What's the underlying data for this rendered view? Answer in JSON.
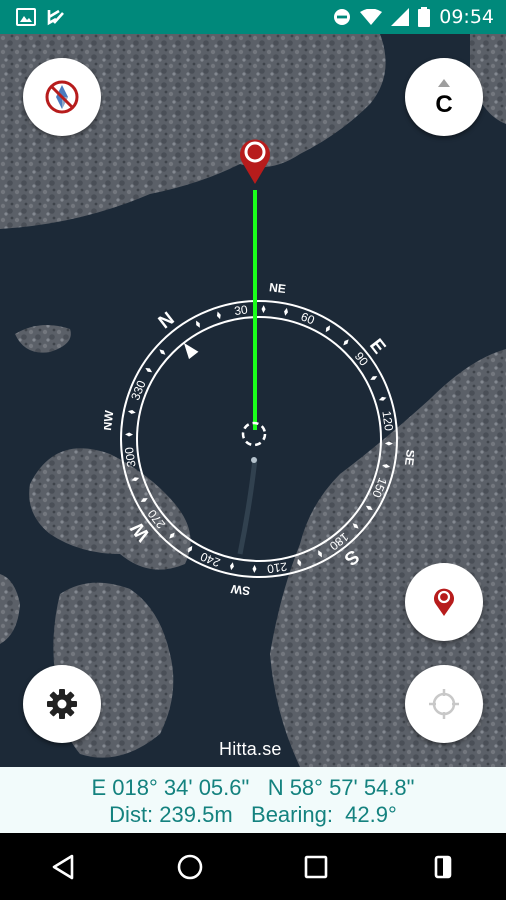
{
  "status_bar": {
    "time": "09:54",
    "icons": [
      "image-icon",
      "download-check-icon",
      "do-not-disturb-icon",
      "wifi-icon",
      "cell-signal-icon",
      "battery-icon"
    ]
  },
  "map": {
    "attribution": "Hitta.se",
    "compass": {
      "cardinals": [
        "N",
        "E",
        "S",
        "W"
      ],
      "intercardinals": [
        "NE",
        "SE",
        "SW",
        "NW"
      ],
      "degree_labels": [
        "30",
        "60",
        "90",
        "120",
        "150",
        "180",
        "210",
        "240",
        "270",
        "300",
        "330"
      ]
    },
    "buttons": {
      "compass_toggle": "compass-disabled-icon",
      "center": "C",
      "mark_location": "location-pin-icon",
      "my_location": "crosshair-icon",
      "settings": "gear-icon"
    }
  },
  "info": {
    "longitude": "E 018° 34' 05.6\"",
    "latitude": "N 58° 57' 54.8\"",
    "distance": "Dist: 239.5m",
    "bearing": "Bearing:  42.9°"
  },
  "colors": {
    "status_bar": "#00897b",
    "info_text": "#14827f",
    "bearing_line": "#1aff1a",
    "marker": "#b71c1c"
  },
  "navbar": {
    "icons": [
      "back-icon",
      "home-icon",
      "recents-icon",
      "square-icon"
    ]
  }
}
